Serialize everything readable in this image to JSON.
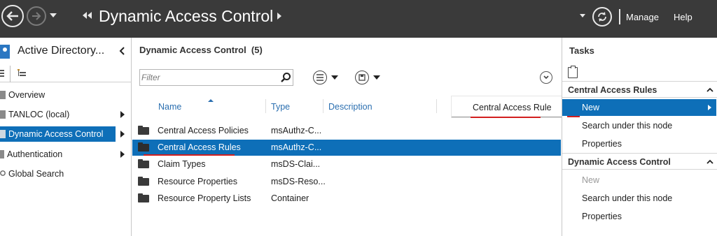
{
  "header": {
    "breadcrumb_title": "Dynamic Access Control",
    "manage_label": "Manage",
    "help_label": "Help"
  },
  "left_panel": {
    "title": "Active Directory...",
    "items": [
      {
        "label": "Overview"
      },
      {
        "label": "TANLOC (local)"
      },
      {
        "label": "Dynamic Access Control"
      },
      {
        "label": "Authentication"
      },
      {
        "label": "Global Search"
      }
    ]
  },
  "center_panel": {
    "title": "Dynamic Access Control  (5)",
    "filter_placeholder": "Filter",
    "columns": {
      "name": "Name",
      "type": "Type",
      "description": "Description"
    },
    "rows": [
      {
        "name": "Central Access Policies",
        "type": "msAuthz-C..."
      },
      {
        "name": "Central Access Rules",
        "type": "msAuthz-C..."
      },
      {
        "name": "Claim Types",
        "type": "msDS-Clai..."
      },
      {
        "name": "Resource Properties",
        "type": "msDS-Reso..."
      },
      {
        "name": "Resource Property Lists",
        "type": "Container"
      }
    ],
    "selected_row": "Central Access Rules"
  },
  "popup_menu": {
    "item": "Central Access Rule"
  },
  "tasks_panel": {
    "title": "Tasks",
    "sections": [
      {
        "title": "Central Access Rules",
        "items": [
          {
            "label": "New"
          },
          {
            "label": "Search under this node"
          },
          {
            "label": "Properties"
          }
        ]
      },
      {
        "title": "Dynamic Access Control",
        "items": [
          {
            "label": "New"
          },
          {
            "label": "Search under this node"
          },
          {
            "label": "Properties"
          }
        ]
      }
    ]
  },
  "colors": {
    "titlebar": "#3a3a3a",
    "selection": "#0e6fb8",
    "header_text": "#2b6fb0",
    "annotation_red": "#d21f1f"
  }
}
